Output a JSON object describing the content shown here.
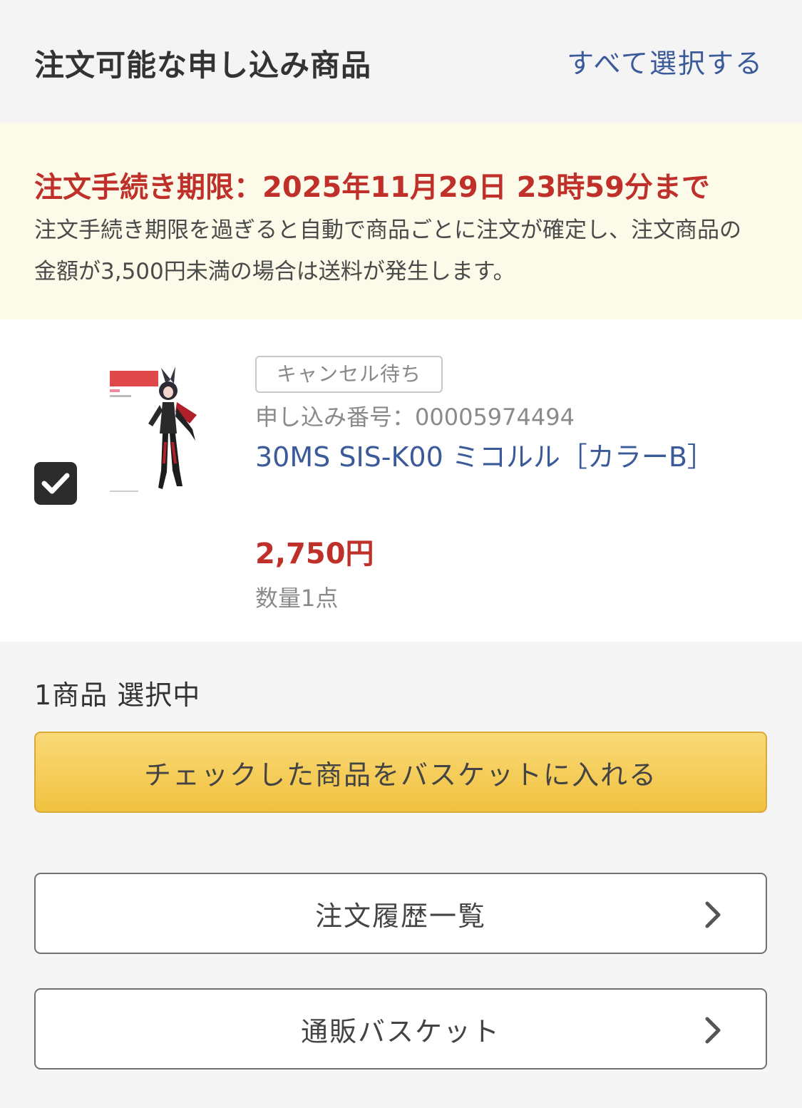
{
  "header": {
    "title": "注文可能な申し込み商品",
    "select_all": "すべて選択する"
  },
  "notice": {
    "deadline": "注文手続き期限：2025年11月29日 23時59分まで",
    "description": "注文手続き期限を過ぎると自動で商品ごとに注文が確定し、注文商品の金額が3,500円未満の場合は送料が発生します。"
  },
  "product": {
    "checked": true,
    "status": "キャンセル待ち",
    "order_number": "申し込み番号：00005974494",
    "name": "30MS SIS-K00 ミコルル［カラーB］",
    "price": "2,750円",
    "quantity": "数量1点"
  },
  "footer": {
    "selected_count": "1商品 選択中",
    "add_to_basket": "チェックした商品をバスケットに入れる",
    "order_history": "注文履歴一覧",
    "mail_order_basket": "通販バスケット"
  },
  "colors": {
    "accent_link": "#3b5a9a",
    "deadline_red": "#c0302a",
    "notice_bg": "#fcfbe9",
    "primary_button": "#f1c240"
  },
  "icons": [
    "check-icon",
    "chevron-right-icon"
  ]
}
